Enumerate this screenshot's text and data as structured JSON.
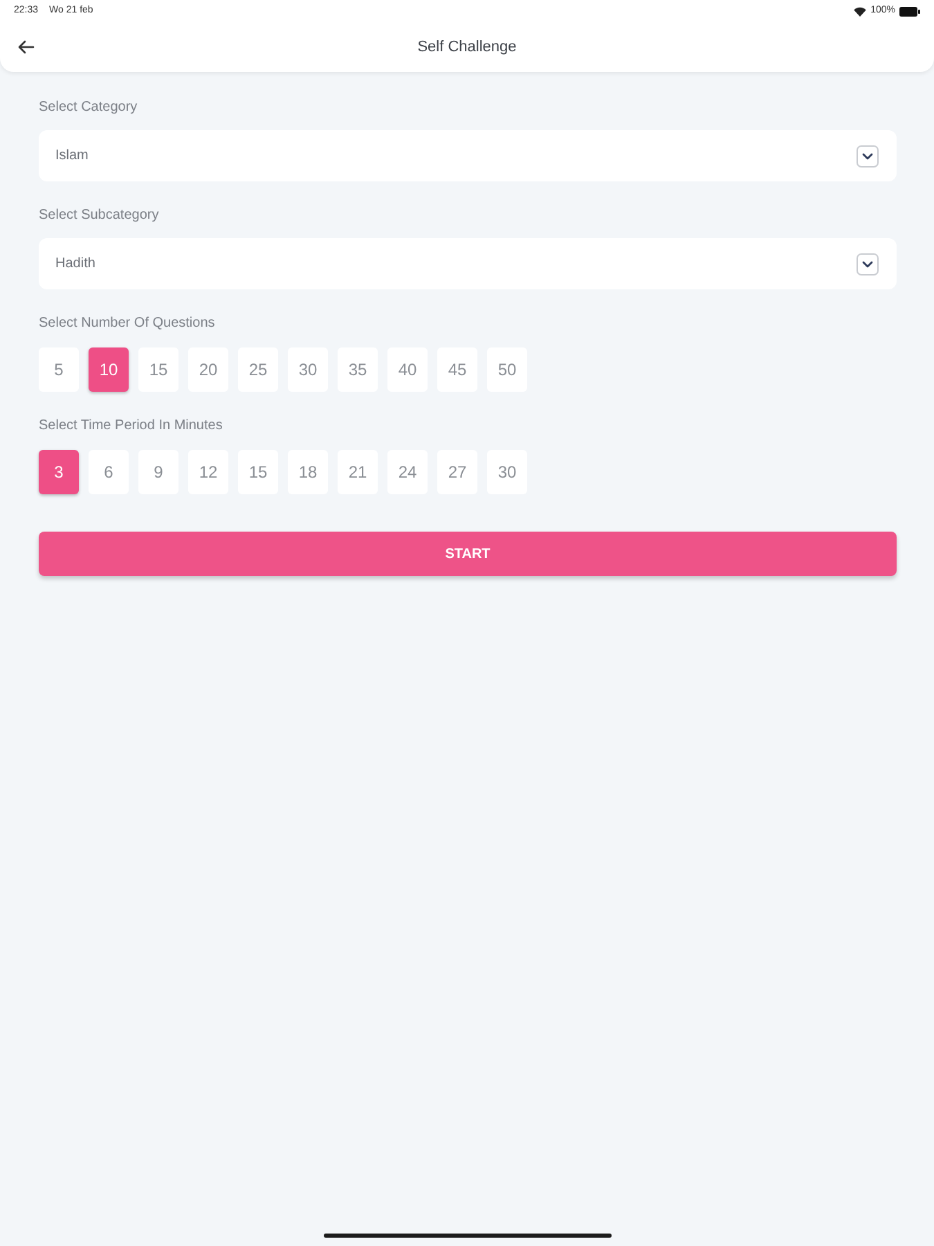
{
  "status_bar": {
    "time": "22:33",
    "date": "Wo 21 feb",
    "battery": "100%"
  },
  "header": {
    "title": "Self Challenge"
  },
  "category": {
    "label": "Select Category",
    "value": "Islam"
  },
  "subcategory": {
    "label": "Select Subcategory",
    "value": "Hadith"
  },
  "questions": {
    "label": "Select Number Of Questions",
    "options": [
      {
        "label": "5",
        "selected": false
      },
      {
        "label": "10",
        "selected": true
      },
      {
        "label": "15",
        "selected": false
      },
      {
        "label": "20",
        "selected": false
      },
      {
        "label": "25",
        "selected": false
      },
      {
        "label": "30",
        "selected": false
      },
      {
        "label": "35",
        "selected": false
      },
      {
        "label": "40",
        "selected": false
      },
      {
        "label": "45",
        "selected": false
      },
      {
        "label": "50",
        "selected": false
      }
    ]
  },
  "time_period": {
    "label": "Select Time Period In Minutes",
    "options": [
      {
        "label": "3",
        "selected": true
      },
      {
        "label": "6",
        "selected": false
      },
      {
        "label": "9",
        "selected": false
      },
      {
        "label": "12",
        "selected": false
      },
      {
        "label": "15",
        "selected": false
      },
      {
        "label": "18",
        "selected": false
      },
      {
        "label": "21",
        "selected": false
      },
      {
        "label": "24",
        "selected": false
      },
      {
        "label": "27",
        "selected": false
      },
      {
        "label": "30",
        "selected": false
      }
    ]
  },
  "start_button": {
    "label": "START"
  }
}
